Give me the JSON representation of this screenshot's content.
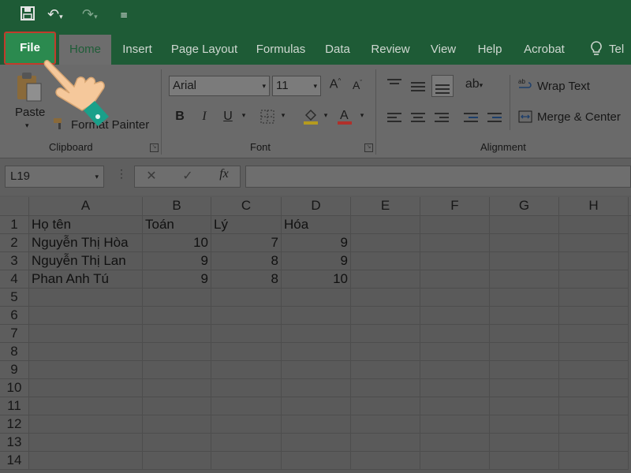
{
  "quick_access": {
    "tell_me_prefix": "Tel"
  },
  "tabs": {
    "file": "File",
    "home": "Home",
    "insert": "Insert",
    "page_layout": "Page Layout",
    "formulas": "Formulas",
    "data": "Data",
    "review": "Review",
    "view": "View",
    "help": "Help",
    "acrobat": "Acrobat"
  },
  "ribbon": {
    "clipboard": {
      "label": "Clipboard",
      "paste": "Paste",
      "format_painter": "Format Painter"
    },
    "font": {
      "label": "Font",
      "font_name": "Arial",
      "font_size": "11",
      "bold": "B",
      "italic": "I",
      "underline": "U",
      "font_color_accent": "#c0392b"
    },
    "alignment": {
      "label": "Alignment",
      "wrap_text": "Wrap Text",
      "merge_center": "Merge & Center"
    }
  },
  "formula_bar": {
    "name_box": "L19",
    "fx": "fx",
    "value": ""
  },
  "sheet": {
    "columns": [
      "A",
      "B",
      "C",
      "D",
      "E",
      "F",
      "G",
      "H"
    ],
    "row_numbers": [
      "1",
      "2",
      "3",
      "4",
      "5",
      "6",
      "7",
      "8",
      "9",
      "10",
      "11",
      "12",
      "13",
      "14"
    ],
    "rows": [
      [
        "Họ tên",
        "Toán",
        "Lý",
        "Hóa"
      ],
      [
        "Nguyễn Thị Hòa",
        "10",
        "7",
        "9"
      ],
      [
        "Nguyễn Thị Lan",
        "9",
        "8",
        "9"
      ],
      [
        "Phan Anh Tú",
        "9",
        "8",
        "10"
      ]
    ]
  }
}
